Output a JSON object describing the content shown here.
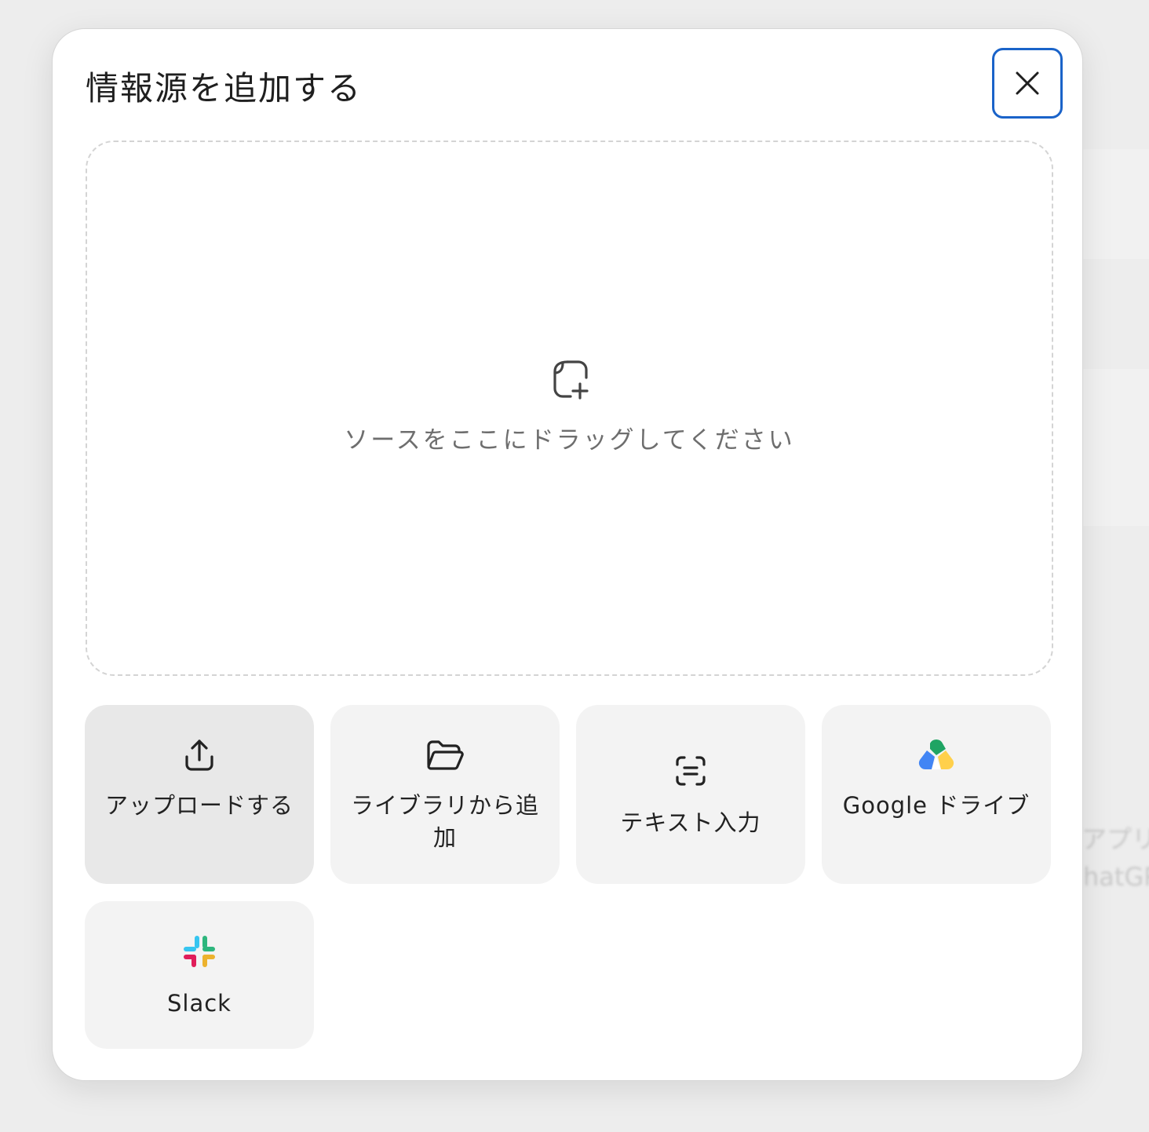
{
  "background": {
    "partial_text_1": "アプリ",
    "partial_text_2": "hatGP"
  },
  "dialog": {
    "title": "情報源を追加する",
    "close_icon": "close-icon",
    "dropzone": {
      "icon": "add-file-icon",
      "text": "ソースをここにドラッグしてください"
    },
    "options": [
      {
        "icon": "upload-icon",
        "label": "アップロードする"
      },
      {
        "icon": "folder-icon",
        "label": "ライブラリから追加"
      },
      {
        "icon": "text-scan-icon",
        "label": "テキスト入力"
      },
      {
        "icon": "google-drive-icon",
        "label": "Google ドライブ"
      },
      {
        "icon": "slack-icon",
        "label": "Slack"
      }
    ]
  },
  "colors": {
    "focus_ring": "#1a63c9",
    "tile_bg": "#f3f3f3",
    "tile_active_bg": "#e8e8e8"
  }
}
